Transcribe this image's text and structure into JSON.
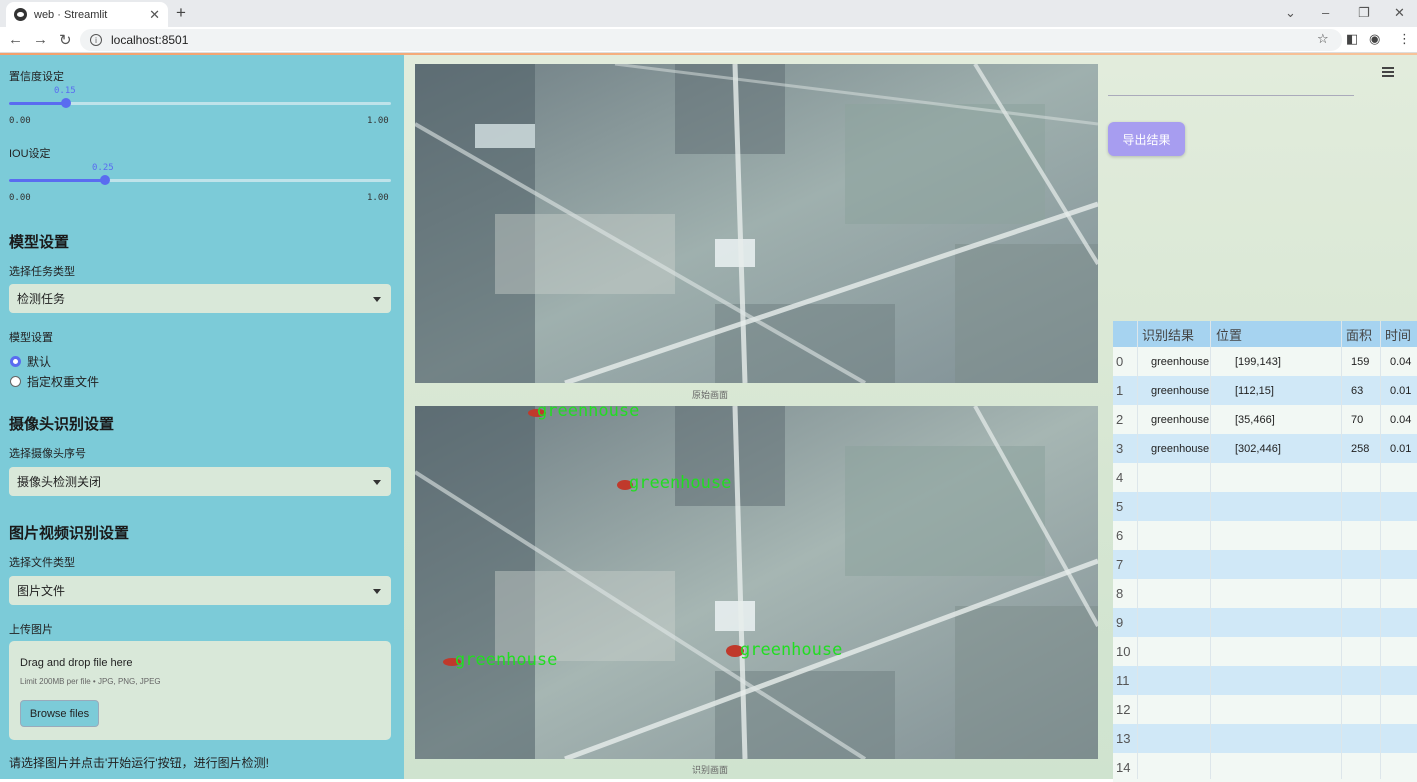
{
  "browser": {
    "tab_title": "web · Streamlit",
    "url": "localhost:8501"
  },
  "sidebar": {
    "conf_label": "置信度设定",
    "conf_value": "0.15",
    "conf_fraction": 0.15,
    "conf_min": "0.00",
    "conf_max": "1.00",
    "iou_label": "IOU设定",
    "iou_value": "0.25",
    "iou_fraction": 0.25,
    "iou_min": "0.00",
    "iou_max": "1.00",
    "model_section": "模型设置",
    "task_label": "选择任务类型",
    "task_value": "检测任务",
    "weights_label": "模型设置",
    "weights_options": [
      "默认",
      "指定权重文件"
    ],
    "weights_selected": "默认",
    "camera_section": "摄像头识别设置",
    "camera_label": "选择摄像头序号",
    "camera_value": "摄像头检测关闭",
    "media_section": "图片视频识别设置",
    "filetype_label": "选择文件类型",
    "filetype_value": "图片文件",
    "upload_label": "上传图片",
    "upload_title": "Drag and drop file here",
    "upload_limit": "Limit 200MB per file • JPG, PNG, JPEG",
    "browse_label": "Browse files",
    "hint": "请选择图片并点击'开始运行'按钮，进行图片检测!"
  },
  "main": {
    "original_caption": "原始画面",
    "result_caption": "识别画面",
    "export_label": "导出结果",
    "detection_label": "greenhouse",
    "table": {
      "headers": [
        "识别结果",
        "位置",
        "面积",
        "时间"
      ],
      "rows": [
        {
          "index": "0",
          "result": "greenhouse",
          "pos": "[199,143]",
          "area": "159",
          "time": "0.04"
        },
        {
          "index": "1",
          "result": "greenhouse",
          "pos": "[112,15]",
          "area": "63",
          "time": "0.01"
        },
        {
          "index": "2",
          "result": "greenhouse",
          "pos": "[35,466]",
          "area": "70",
          "time": "0.04"
        },
        {
          "index": "3",
          "result": "greenhouse",
          "pos": "[302,446]",
          "area": "258",
          "time": "0.01"
        }
      ],
      "empty_indices": [
        "4",
        "5",
        "6",
        "7",
        "8",
        "9",
        "10",
        "11",
        "12",
        "13",
        "14"
      ]
    }
  }
}
